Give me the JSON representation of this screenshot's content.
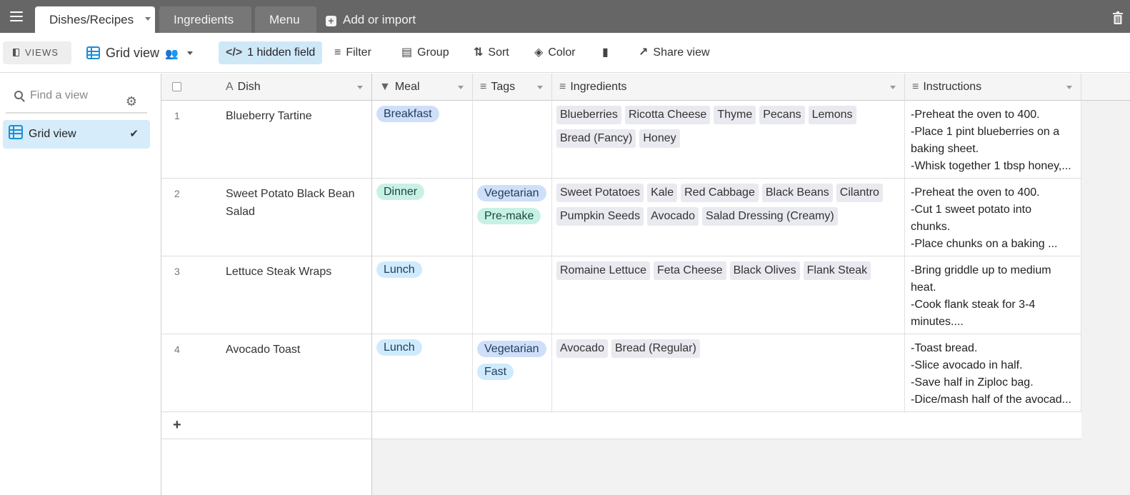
{
  "tabs": [
    {
      "label": "Dishes/Recipes",
      "active": true
    },
    {
      "label": "Ingredients",
      "active": false
    },
    {
      "label": "Menu",
      "active": false
    }
  ],
  "add_import": "Add or import",
  "toolbar": {
    "views": "VIEWS",
    "current_view": "Grid view",
    "hidden_field": "1 hidden field",
    "filter": "Filter",
    "group": "Group",
    "sort": "Sort",
    "color": "Color",
    "share_view": "Share view"
  },
  "sidebar": {
    "find_placeholder": "Find a view",
    "views": [
      {
        "label": "Grid view",
        "selected": true
      }
    ]
  },
  "columns": [
    {
      "name": "Dish",
      "icon": "text-icon"
    },
    {
      "name": "Meal",
      "icon": "single-select-icon"
    },
    {
      "name": "Tags",
      "icon": "multi-select-icon"
    },
    {
      "name": "Ingredients",
      "icon": "linked-record-icon"
    },
    {
      "name": "Instructions",
      "icon": "long-text-icon"
    }
  ],
  "rows": [
    {
      "num": "1",
      "dish": "Blueberry Tartine",
      "meal": "Breakfast",
      "tags": [],
      "ingredients": [
        "Blueberries",
        "Ricotta Cheese",
        "Thyme",
        "Pecans",
        "Lemons",
        "Bread (Fancy)",
        "Honey"
      ],
      "instructions": [
        "-Preheat the oven to 400.",
        "-Place 1 pint blueberries on a",
        "baking sheet.",
        "-Whisk together 1 tbsp honey,..."
      ]
    },
    {
      "num": "2",
      "dish": "Sweet Potato Black Bean Salad",
      "meal": "Dinner",
      "tags": [
        "Vegetarian",
        "Pre-make"
      ],
      "ingredients": [
        "Sweet Potatoes",
        "Kale",
        "Red Cabbage",
        "Black Beans",
        "Cilantro",
        "Pumpkin Seeds",
        "Avocado",
        "Salad Dressing (Creamy)"
      ],
      "instructions": [
        "-Preheat the oven to 400.",
        "-Cut 1 sweet potato into",
        "chunks.",
        "-Place chunks on a baking ..."
      ]
    },
    {
      "num": "3",
      "dish": "Lettuce Steak Wraps",
      "meal": "Lunch",
      "tags": [],
      "ingredients": [
        "Romaine Lettuce",
        "Feta Cheese",
        "Black Olives",
        "Flank Steak"
      ],
      "instructions": [
        "-Bring griddle up to medium",
        "heat.",
        "-Cook flank steak for 3-4",
        "minutes...."
      ]
    },
    {
      "num": "4",
      "dish": "Avocado Toast",
      "meal": "Lunch",
      "tags": [
        "Vegetarian",
        "Fast"
      ],
      "ingredients": [
        "Avocado",
        "Bread (Regular)"
      ],
      "instructions": [
        "-Toast bread.",
        "-Slice avocado in half.",
        "-Save half in Ziploc bag.",
        "-Dice/mash half of the avocad..."
      ]
    }
  ],
  "add_row": "+"
}
